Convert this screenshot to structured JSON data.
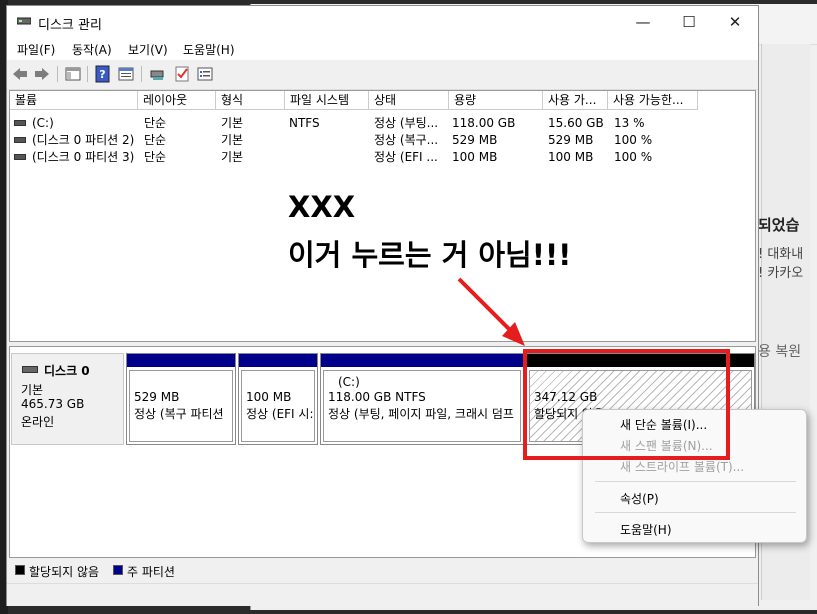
{
  "window": {
    "title": "디스크 관리",
    "minimize_glyph": "—",
    "maximize_glyph": "☐",
    "close_glyph": "✕"
  },
  "menu": [
    "파일(F)",
    "동작(A)",
    "보기(V)",
    "도움말(H)"
  ],
  "toolbar_icons": [
    "back-arrow-icon",
    "forward-arrow-icon",
    "console-tree-icon",
    "help-icon",
    "properties-icon",
    "connect-icon",
    "check-icon",
    "list-icon"
  ],
  "volumes": {
    "headers": [
      "볼륨",
      "레이아웃",
      "형식",
      "파일 시스템",
      "상태",
      "용량",
      "사용 가...",
      "사용 가능한..."
    ],
    "rows": [
      [
        "(C:)",
        "단순",
        "기본",
        "NTFS",
        "정상 (부팅...",
        "118.00 GB",
        "15.60 GB",
        "13 %"
      ],
      [
        "(디스크 0 파티션 2)",
        "단순",
        "기본",
        "",
        "정상 (복구...",
        "529 MB",
        "529 MB",
        "100 %"
      ],
      [
        "(디스크 0 파티션 3)",
        "단순",
        "기본",
        "",
        "정상 (EFI ...",
        "100 MB",
        "100 MB",
        "100 %"
      ]
    ]
  },
  "disk": {
    "name": "디스크 0",
    "type": "기본",
    "size": "465.73 GB",
    "status": "온라인",
    "partitions": [
      {
        "line1": "",
        "line2": "529 MB",
        "line3": "정상 (복구 파티션"
      },
      {
        "line1": "",
        "line2": "100 MB",
        "line3": "정상 (EFI 시:"
      },
      {
        "line1": "(C:)",
        "line2": "118.00 GB NTFS",
        "line3": "정상 (부팅, 페이지 파일, 크래시 덤프"
      },
      {
        "line1": "",
        "line2": "347.12 GB",
        "line3": "할당되지 않음"
      }
    ]
  },
  "legend": {
    "unallocated": "할당되지 않음",
    "primary": "주 파티션",
    "unallocated_color": "#000000",
    "primary_color": "#00008b"
  },
  "context_menu": {
    "new_simple_volume": "새 단순 볼륨(I)...",
    "new_spanned_volume": "새 스팬 볼륨(N)...",
    "new_striped_volume": "새 스트라이프 볼륨(T)...",
    "properties": "속성(P)",
    "help": "도움말(H)"
  },
  "annotation": {
    "line1": "XXX",
    "line2": "이거 누르는 거 아님!!!",
    "color": "#e41e1e"
  },
  "background_text": [
    "되었습",
    "! 대화내",
    "! 카카오",
    "용 복원"
  ]
}
